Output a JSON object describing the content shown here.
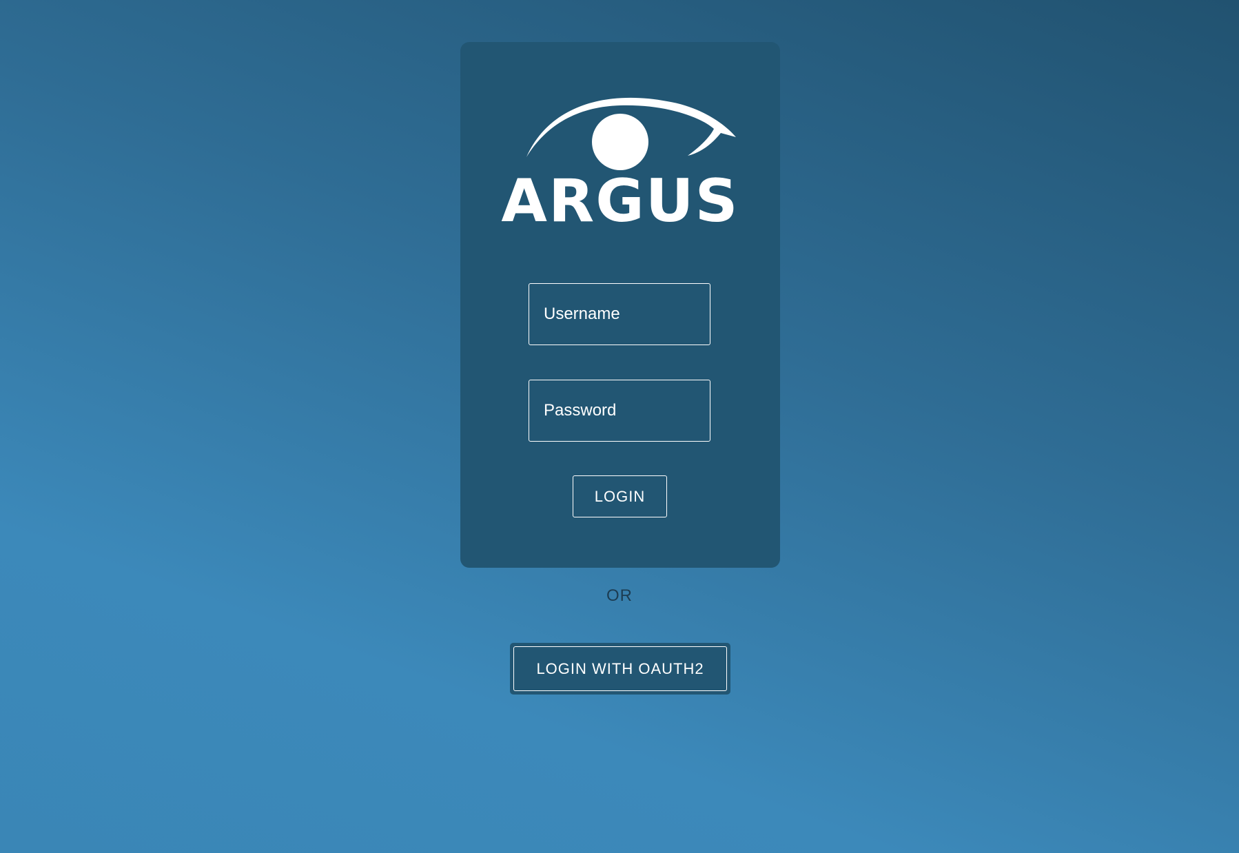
{
  "brand": {
    "logo_text": "ARGUS",
    "logo_icon": "eye-icon"
  },
  "login_form": {
    "username_placeholder": "Username",
    "password_placeholder": "Password",
    "login_label": "LOGIN"
  },
  "separator_text": "OR",
  "oauth": {
    "button_label": "LOGIN WITH OAUTH2"
  },
  "colors": {
    "card_background": "#225673",
    "background_light": "#3c89ba",
    "background_dark": "#215270",
    "separator_text": "#1c3c52",
    "foreground": "#ffffff"
  }
}
